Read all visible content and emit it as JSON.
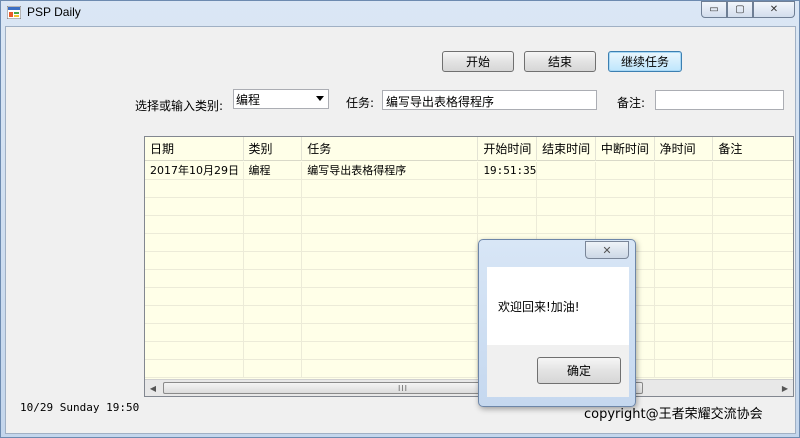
{
  "window": {
    "title": "PSP Daily",
    "caption_buttons": {
      "minimize": "▭",
      "maximize": "▢",
      "close": "✕"
    }
  },
  "toolbar": {
    "start_label": "开始",
    "end_label": "结束",
    "continue_label": "继续任务"
  },
  "form": {
    "category_label": "选择或输入类别:",
    "category_value": "编程",
    "task_label": "任务:",
    "task_value": "编写导出表格得程序",
    "note_label": "备注:",
    "note_value": ""
  },
  "grid": {
    "columns": [
      "日期",
      "类别",
      "任务",
      "开始时间",
      "结束时间",
      "中断时间",
      "净时间",
      "备注"
    ],
    "rows": [
      [
        "2017年10月29日",
        "编程",
        "编写导出表格得程序",
        "19:51:35",
        "",
        "",
        "",
        ""
      ]
    ],
    "scrollbar_thumb": "III"
  },
  "status": {
    "datetime": "10/29  Sunday 19:50"
  },
  "footer": {
    "copyright": "copyright@王者荣耀交流协会"
  },
  "dialog": {
    "close_glyph": "✕",
    "message": "欢迎回来!加油!",
    "ok_label": "确定"
  }
}
